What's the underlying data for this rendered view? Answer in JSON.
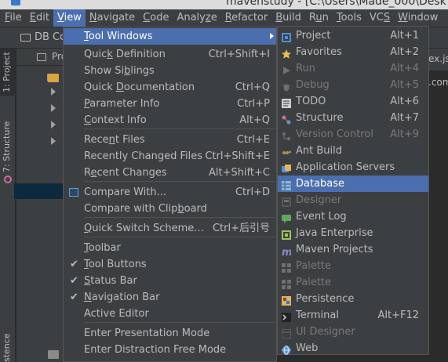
{
  "window": {
    "title": "mavenstudy - [C:\\Users\\Made_000\\Desk"
  },
  "menubar": [
    {
      "label": "File",
      "mnemonic": "F",
      "rest": "ile"
    },
    {
      "label": "Edit",
      "mnemonic": "E",
      "rest": "dit"
    },
    {
      "label": "View",
      "mnemonic": "V",
      "rest": "iew"
    },
    {
      "label": "Navigate",
      "mnemonic": "N",
      "rest": "avigate"
    },
    {
      "label": "Code",
      "mnemonic": "C",
      "rest": "ode"
    },
    {
      "label": "Analyze",
      "pre": "Analy",
      "mnemonic": "z",
      "rest": "e"
    },
    {
      "label": "Refactor",
      "mnemonic": "R",
      "rest": "efactor"
    },
    {
      "label": "Build",
      "mnemonic": "B",
      "rest": "uild"
    },
    {
      "label": "Run",
      "pre": "R",
      "mnemonic": "u",
      "rest": "n"
    },
    {
      "label": "Tools",
      "mnemonic": "T",
      "rest": "ools"
    },
    {
      "label": "VCS",
      "pre": "VC",
      "mnemonic": "S",
      "rest": ""
    },
    {
      "label": "Window",
      "mnemonic": "W",
      "rest": "indow"
    }
  ],
  "toolbar": {
    "breadcrumb": "DB Co"
  },
  "left_stripe": {
    "project": "1: Project",
    "structure": "7: Structure",
    "persistence": "stence"
  },
  "project_panel": {
    "header": "Pro"
  },
  "editor": {
    "tab": "ex.js",
    "line": ".com"
  },
  "view_menu": {
    "items": [
      {
        "label": "Tool Windows",
        "pre": "",
        "mnemonic": "T",
        "rest": "ool Windows",
        "shortcut": "",
        "submenu": true,
        "highlighted": true
      },
      {
        "label": "Quick Definition",
        "pre": "Quic",
        "mnemonic": "k",
        "rest": " Definition",
        "shortcut": "Ctrl+Shift+I"
      },
      {
        "label": "Show Siblings",
        "pre": "Show Si",
        "mnemonic": "b",
        "rest": "lings",
        "shortcut": ""
      },
      {
        "label": "Quick Documentation",
        "pre": "Quick ",
        "mnemonic": "D",
        "rest": "ocumentation",
        "shortcut": "Ctrl+Q"
      },
      {
        "label": "Parameter Info",
        "pre": "",
        "mnemonic": "P",
        "rest": "arameter Info",
        "shortcut": "Ctrl+P"
      },
      {
        "label": "Context Info",
        "pre": "",
        "mnemonic": "C",
        "rest": "ontext Info",
        "shortcut": "Alt+Q"
      },
      {
        "label": "Recent Files",
        "pre": "Rece",
        "mnemonic": "n",
        "rest": "t Files",
        "shortcut": "Ctrl+E"
      },
      {
        "label": "Recently Changed Files",
        "pre": "Recently Changed Files",
        "mnemonic": "",
        "rest": "",
        "shortcut": "Ctrl+Shift+E"
      },
      {
        "label": "Recent Changes",
        "pre": "R",
        "mnemonic": "e",
        "rest": "cent Changes",
        "shortcut": "Alt+Shift+C"
      },
      {
        "label": "Compare With...",
        "pre": "Compare With...",
        "mnemonic": "",
        "rest": "",
        "shortcut": "Ctrl+D",
        "icon": true
      },
      {
        "label": "Compare with Clipboard",
        "pre": "Compare with Clip",
        "mnemonic": "b",
        "rest": "oard",
        "shortcut": ""
      },
      {
        "label": "Quick Switch Scheme...",
        "pre": "",
        "mnemonic": "Q",
        "rest": "uick Switch Scheme...",
        "shortcut": "Ctrl+后引号"
      },
      {
        "label": "Toolbar",
        "pre": "",
        "mnemonic": "T",
        "rest": "oolbar",
        "shortcut": ""
      },
      {
        "label": "Tool Buttons",
        "pre": "",
        "mnemonic": "T",
        "rest": "ool Buttons",
        "shortcut": "",
        "checked": true
      },
      {
        "label": "Status Bar",
        "pre": "",
        "mnemonic": "S",
        "rest": "tatus Bar",
        "shortcut": "",
        "checked": true
      },
      {
        "label": "Navigation Bar",
        "pre": "",
        "mnemonic": "N",
        "rest": "avigation Bar",
        "shortcut": "",
        "checked": true
      },
      {
        "label": "Active Editor",
        "pre": "Active Editor",
        "mnemonic": "",
        "rest": "",
        "shortcut": ""
      },
      {
        "label": "Enter Presentation Mode",
        "pre": "Enter Presentation Mode",
        "mnemonic": "",
        "rest": "",
        "shortcut": ""
      },
      {
        "label": "Enter Distraction Free Mode",
        "pre": "Enter Distraction Free Mode",
        "mnemonic": "",
        "rest": "",
        "shortcut": ""
      }
    ]
  },
  "tool_windows_menu": {
    "items": [
      {
        "label": "Project",
        "shortcut": "Alt+1",
        "icon": "project-icon",
        "color": "#4a8fd6"
      },
      {
        "label": "Favorites",
        "shortcut": "Alt+2",
        "icon": "favorites-star-icon",
        "color": "#e8c34a"
      },
      {
        "label": "Run",
        "shortcut": "Alt+4",
        "icon": "run-icon",
        "color": "#6f6f6f",
        "disabled": true
      },
      {
        "label": "Debug",
        "shortcut": "Alt+5",
        "icon": "debug-icon",
        "color": "#6f6f6f",
        "disabled": true
      },
      {
        "label": "TODO",
        "shortcut": "Alt+6",
        "icon": "todo-icon",
        "color": "#d0d0d0"
      },
      {
        "label": "Structure",
        "shortcut": "Alt+7",
        "icon": "structure-icon",
        "color": "#cc6d98"
      },
      {
        "label": "Version Control",
        "shortcut": "Alt+9",
        "icon": "version-control-icon",
        "color": "#6f6f6f",
        "disabled": true
      },
      {
        "label": "Ant Build",
        "shortcut": "",
        "icon": "ant-build-icon",
        "color": "#b08d5a"
      },
      {
        "label": "Application Servers",
        "shortcut": "",
        "icon": "application-servers-icon",
        "color": "#e0b85a"
      },
      {
        "label": "Database",
        "shortcut": "",
        "icon": "database-icon",
        "color": "#8fb4d9",
        "highlighted": true
      },
      {
        "label": "Designer",
        "shortcut": "",
        "icon": "designer-icon",
        "color": "#6f6f6f",
        "disabled": true
      },
      {
        "label": "Event Log",
        "shortcut": "",
        "icon": "event-log-icon",
        "color": "#5fa859"
      },
      {
        "label": "Java Enterprise",
        "shortcut": "",
        "icon": "java-enterprise-icon",
        "color": "#9fc25a"
      },
      {
        "label": "Maven Projects",
        "shortcut": "",
        "icon": "maven-icon",
        "color": "#8a8ac8"
      },
      {
        "label": "Palette",
        "shortcut": "",
        "icon": "palette-icon",
        "color": "#6f6f6f",
        "disabled": true
      },
      {
        "label": "Palette",
        "shortcut": "",
        "icon": "palette-icon",
        "color": "#6f6f6f",
        "disabled": true
      },
      {
        "label": "Persistence",
        "shortcut": "",
        "icon": "persistence-icon",
        "color": "#d9b46a"
      },
      {
        "label": "Terminal",
        "shortcut": "Alt+F12",
        "icon": "terminal-icon",
        "color": "#d0d0d0"
      },
      {
        "label": "UI Designer",
        "shortcut": "",
        "icon": "ui-designer-icon",
        "color": "#6f6f6f",
        "disabled": true
      },
      {
        "label": "Web",
        "shortcut": "",
        "icon": "web-icon",
        "color": "#5a96d6"
      }
    ]
  },
  "colors": {
    "menu_bg": "#3c3f41",
    "highlight": "#4b6eaf",
    "text": "#bbbbbb",
    "disabled": "#787878"
  }
}
